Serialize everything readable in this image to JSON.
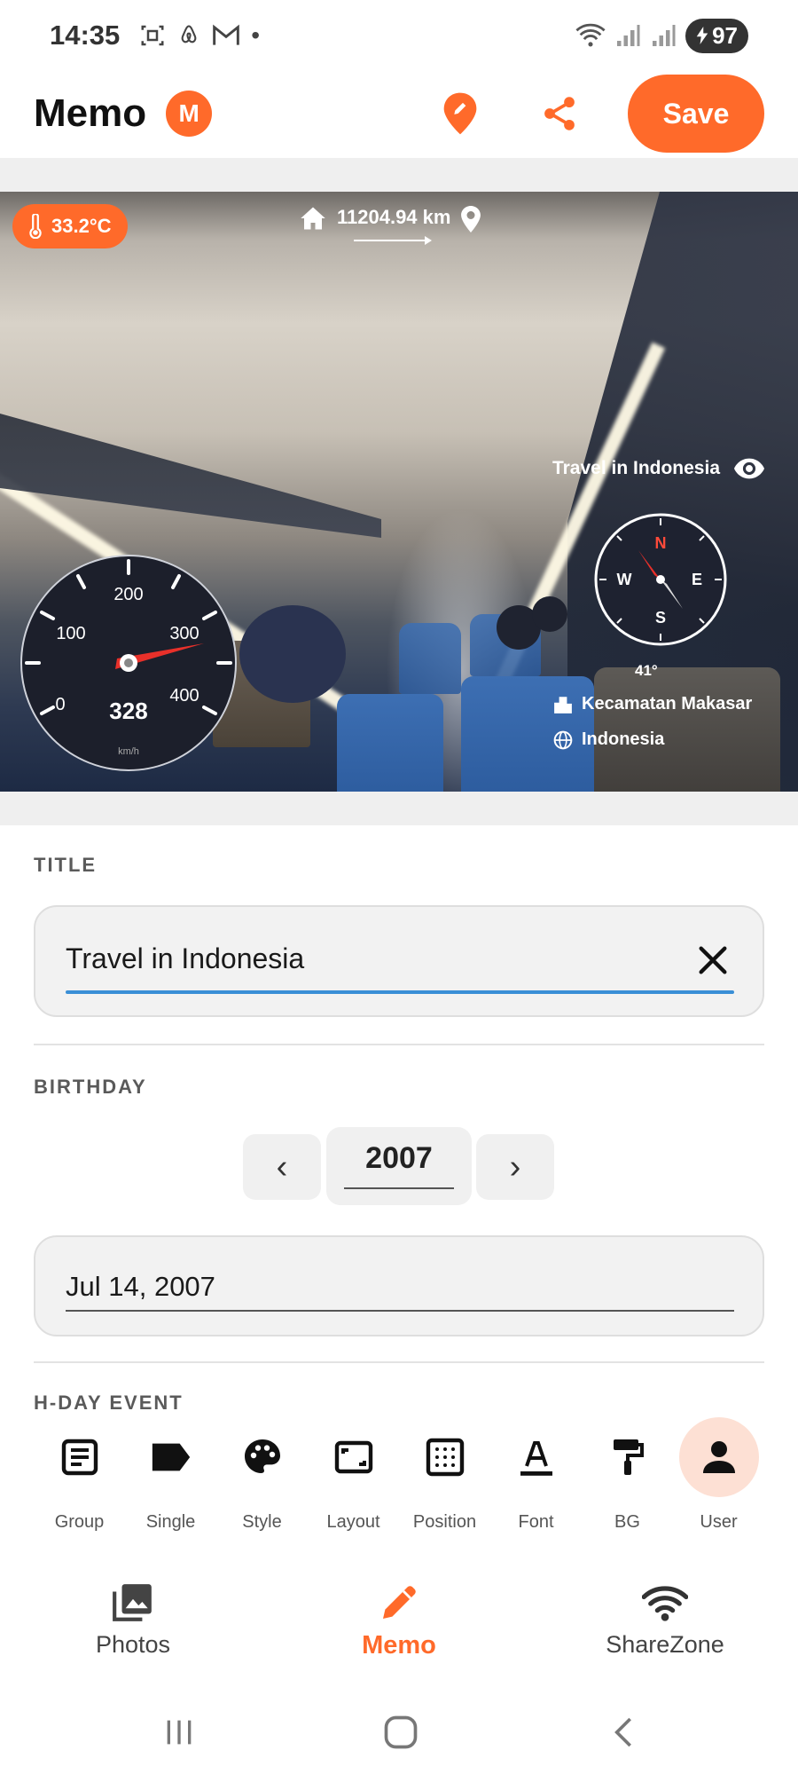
{
  "status_bar": {
    "time": "14:35",
    "battery": "97"
  },
  "app_bar": {
    "title": "Memo",
    "badge": "M",
    "save_label": "Save"
  },
  "photo": {
    "temperature": "33.2°C",
    "distance": "11204.94 km",
    "overlay_title": "Travel in Indonesia",
    "compass": {
      "n": "N",
      "e": "E",
      "s": "S",
      "w": "W",
      "angle": "41°"
    },
    "location": {
      "district": "Kecamatan Makasar",
      "country": "Indonesia"
    },
    "speedometer": {
      "speed": "328",
      "unit": "km/h",
      "ticks": [
        "0",
        "100",
        "200",
        "300",
        "400"
      ]
    }
  },
  "form": {
    "title_label": "TITLE",
    "title_value": "Travel in Indonesia",
    "birthday_label": "BIRTHDAY",
    "year_prev": "‹",
    "year_value": "2007",
    "year_next": "›",
    "date_value": "Jul 14, 2007",
    "hday_label": "H-DAY EVENT"
  },
  "toolbar": {
    "items": [
      {
        "label": "Group",
        "icon": "group-icon"
      },
      {
        "label": "Single",
        "icon": "label-tag-icon"
      },
      {
        "label": "Style",
        "icon": "palette-icon"
      },
      {
        "label": "Layout",
        "icon": "layout-icon"
      },
      {
        "label": "Position",
        "icon": "position-grid-icon"
      },
      {
        "label": "Font",
        "icon": "font-icon"
      },
      {
        "label": "BG",
        "icon": "paint-roller-icon"
      },
      {
        "label": "User",
        "icon": "user-icon",
        "active": true
      }
    ]
  },
  "bottom_nav": {
    "items": [
      {
        "label": "Photos",
        "icon": "photos-icon"
      },
      {
        "label": "Memo",
        "icon": "pencil-icon",
        "active": true
      },
      {
        "label": "ShareZone",
        "icon": "wifi-icon"
      }
    ]
  },
  "colors": {
    "accent": "#ff6a2a",
    "focus_underline": "#3a8fd6",
    "accent_light": "#fde0d4"
  }
}
